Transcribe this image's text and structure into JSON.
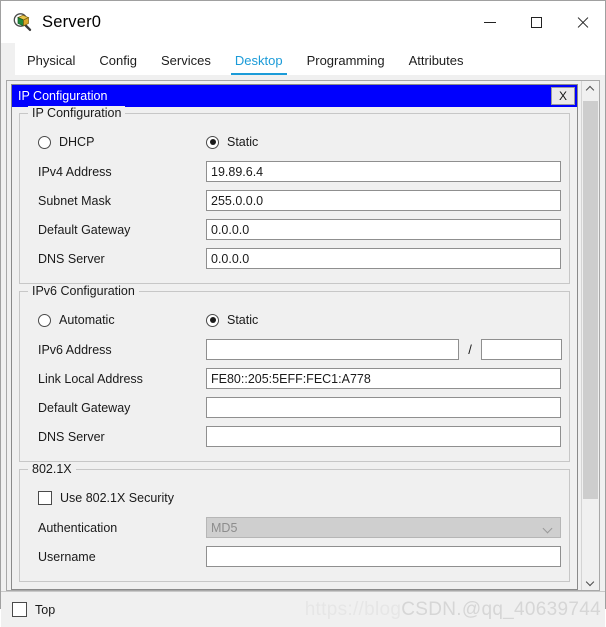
{
  "window": {
    "title": "Server0",
    "icon": "packet-tracer-device-icon",
    "controls": {
      "minimize": "—",
      "maximize": "□",
      "close": "✕"
    }
  },
  "tabs": [
    {
      "label": "Physical",
      "active": false
    },
    {
      "label": "Config",
      "active": false
    },
    {
      "label": "Services",
      "active": false
    },
    {
      "label": "Desktop",
      "active": true
    },
    {
      "label": "Programming",
      "active": false
    },
    {
      "label": "Attributes",
      "active": false
    }
  ],
  "accent_color": "#1b9bd8",
  "app_window": {
    "title": "IP Configuration",
    "close_label": "X",
    "titlebar_color": "#0000fe"
  },
  "ip_config": {
    "group_title": "IP Configuration",
    "mode": {
      "dhcp_label": "DHCP",
      "dhcp_selected": false,
      "static_label": "Static",
      "static_selected": true
    },
    "fields": [
      {
        "label": "IPv4 Address",
        "value": "19.89.6.4"
      },
      {
        "label": "Subnet Mask",
        "value": "255.0.0.0"
      },
      {
        "label": "Default Gateway",
        "value": "0.0.0.0"
      },
      {
        "label": "DNS Server",
        "value": "0.0.0.0"
      }
    ]
  },
  "ipv6_config": {
    "group_title": "IPv6 Configuration",
    "mode": {
      "automatic_label": "Automatic",
      "automatic_selected": false,
      "static_label": "Static",
      "static_selected": true
    },
    "address_row": {
      "label": "IPv6 Address",
      "value": "",
      "separator": "/",
      "prefix_value": ""
    },
    "fields": [
      {
        "label": "Link Local Address",
        "value": "FE80::205:5EFF:FEC1:A778"
      },
      {
        "label": "Default Gateway",
        "value": ""
      },
      {
        "label": "DNS Server",
        "value": ""
      }
    ]
  },
  "dot1x": {
    "group_title": "802.1X",
    "use_security_label": "Use 802.1X Security",
    "use_security_checked": false,
    "authentication_label": "Authentication",
    "authentication_value": "MD5",
    "authentication_disabled": true,
    "username_label": "Username",
    "username_value": ""
  },
  "scrollbar": {
    "up_icon": "chevron-up-icon",
    "down_icon": "chevron-down-icon"
  },
  "bottom_bar": {
    "top_label": "Top",
    "top_checked": false
  },
  "watermark": {
    "part_a": "https://blog",
    "part_b": "CSDN.@qq_40639744"
  }
}
